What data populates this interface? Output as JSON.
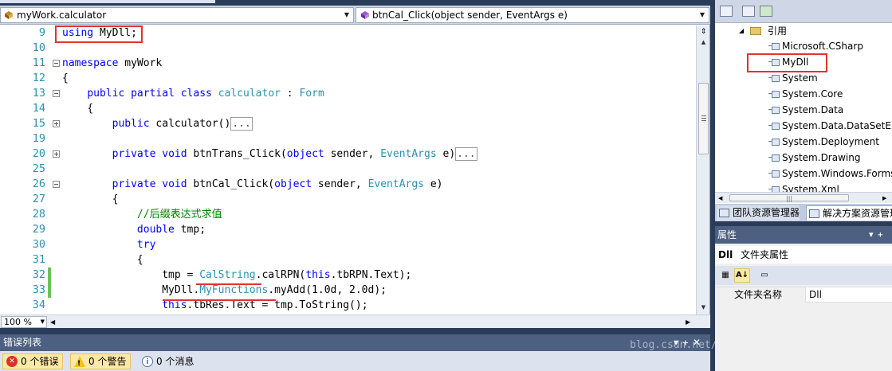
{
  "editor": {
    "class_combo": "myWork.calculator",
    "member_combo": "btnCal_Click(object sender, EventArgs e)",
    "zoom": "100 %",
    "lines": [
      {
        "n": "9",
        "fold": "",
        "changed": false,
        "segs": [
          [
            "kw",
            "using"
          ],
          [
            "",
            " MyDll;"
          ]
        ]
      },
      {
        "n": "10",
        "fold": "",
        "changed": false,
        "segs": []
      },
      {
        "n": "11",
        "fold": "minus",
        "changed": false,
        "segs": [
          [
            "kw",
            "namespace"
          ],
          [
            "",
            " myWork"
          ]
        ]
      },
      {
        "n": "12",
        "fold": "",
        "changed": false,
        "segs": [
          [
            "",
            "{"
          ]
        ]
      },
      {
        "n": "13",
        "fold": "minus",
        "changed": false,
        "segs": [
          [
            "",
            "    "
          ],
          [
            "kw",
            "public"
          ],
          [
            "",
            " "
          ],
          [
            "kw",
            "partial"
          ],
          [
            "",
            " "
          ],
          [
            "kw",
            "class"
          ],
          [
            "",
            " "
          ],
          [
            "ty",
            "calculator"
          ],
          [
            "",
            " : "
          ],
          [
            "ty",
            "Form"
          ]
        ]
      },
      {
        "n": "14",
        "fold": "",
        "changed": false,
        "segs": [
          [
            "",
            "    {"
          ]
        ]
      },
      {
        "n": "15",
        "fold": "plus",
        "changed": false,
        "segs": [
          [
            "",
            "        "
          ],
          [
            "kw",
            "public"
          ],
          [
            "",
            " calculator()"
          ],
          [
            "box",
            "..."
          ]
        ]
      },
      {
        "n": "19",
        "fold": "",
        "changed": false,
        "segs": []
      },
      {
        "n": "20",
        "fold": "plus",
        "changed": false,
        "segs": [
          [
            "",
            "        "
          ],
          [
            "kw",
            "private"
          ],
          [
            "",
            " "
          ],
          [
            "kw",
            "void"
          ],
          [
            "",
            " btnTrans_Click("
          ],
          [
            "kw",
            "object"
          ],
          [
            "",
            " sender, "
          ],
          [
            "ty",
            "EventArgs"
          ],
          [
            "",
            " e)"
          ],
          [
            "box",
            "..."
          ]
        ]
      },
      {
        "n": "25",
        "fold": "",
        "changed": false,
        "segs": []
      },
      {
        "n": "26",
        "fold": "minus",
        "changed": false,
        "segs": [
          [
            "",
            "        "
          ],
          [
            "kw",
            "private"
          ],
          [
            "",
            " "
          ],
          [
            "kw",
            "void"
          ],
          [
            "",
            " btnCal_Click("
          ],
          [
            "kw",
            "object"
          ],
          [
            "",
            " sender, "
          ],
          [
            "ty",
            "EventArgs"
          ],
          [
            "",
            " e)"
          ]
        ]
      },
      {
        "n": "27",
        "fold": "",
        "changed": false,
        "segs": [
          [
            "",
            "        {"
          ]
        ]
      },
      {
        "n": "28",
        "fold": "",
        "changed": false,
        "segs": [
          [
            "",
            "            "
          ],
          [
            "cm",
            "//后缀表达式求值"
          ]
        ]
      },
      {
        "n": "29",
        "fold": "",
        "changed": false,
        "segs": [
          [
            "",
            "            "
          ],
          [
            "kw",
            "double"
          ],
          [
            "",
            " tmp;"
          ]
        ]
      },
      {
        "n": "30",
        "fold": "",
        "changed": false,
        "segs": [
          [
            "",
            "            "
          ],
          [
            "kw",
            "try"
          ]
        ]
      },
      {
        "n": "31",
        "fold": "",
        "changed": false,
        "segs": [
          [
            "",
            "            {"
          ]
        ]
      },
      {
        "n": "32",
        "fold": "",
        "changed": true,
        "segs": [
          [
            "",
            "                tmp = "
          ],
          [
            "ty",
            "CalString"
          ],
          [
            "",
            ".calRPN("
          ],
          [
            "kw",
            "this"
          ],
          [
            "",
            ".tbRPN.Text);"
          ]
        ]
      },
      {
        "n": "33",
        "fold": "",
        "changed": true,
        "segs": [
          [
            "",
            "                MyDll."
          ],
          [
            "ty",
            "MyFunctions"
          ],
          [
            "",
            ".myAdd(1.0d, 2.0d);"
          ]
        ]
      },
      {
        "n": "34",
        "fold": "",
        "changed": false,
        "segs": [
          [
            "",
            "                "
          ],
          [
            "kw",
            "this"
          ],
          [
            "",
            ".tbRes.Text = tmp.ToString();"
          ]
        ]
      }
    ]
  },
  "error_list": {
    "title": "错误列表",
    "errors": "0 个错误",
    "warnings": "0 个警告",
    "messages": "0 个消息"
  },
  "watermark": "blog.csdn.net/yujiaxucheng",
  "solution_explorer": {
    "references_label": "引用",
    "references": [
      "Microsoft.CSharp",
      "MyDll",
      "System",
      "System.Core",
      "System.Data",
      "System.Data.DataSetExtensions",
      "System.Deployment",
      "System.Drawing",
      "System.Windows.Forms",
      "System.Xml"
    ],
    "tab_team": "团队资源管理器",
    "tab_solution": "解决方案资源管理器"
  },
  "properties": {
    "title": "属性",
    "object_name": "Dll",
    "object_type": "文件夹属性",
    "rows": [
      {
        "name": "文件夹名称",
        "value": "Dll"
      }
    ]
  },
  "colors": {
    "highlight": "#e0342f",
    "keyword": "#0000ff",
    "type": "#2b91af",
    "comment": "#008000"
  }
}
